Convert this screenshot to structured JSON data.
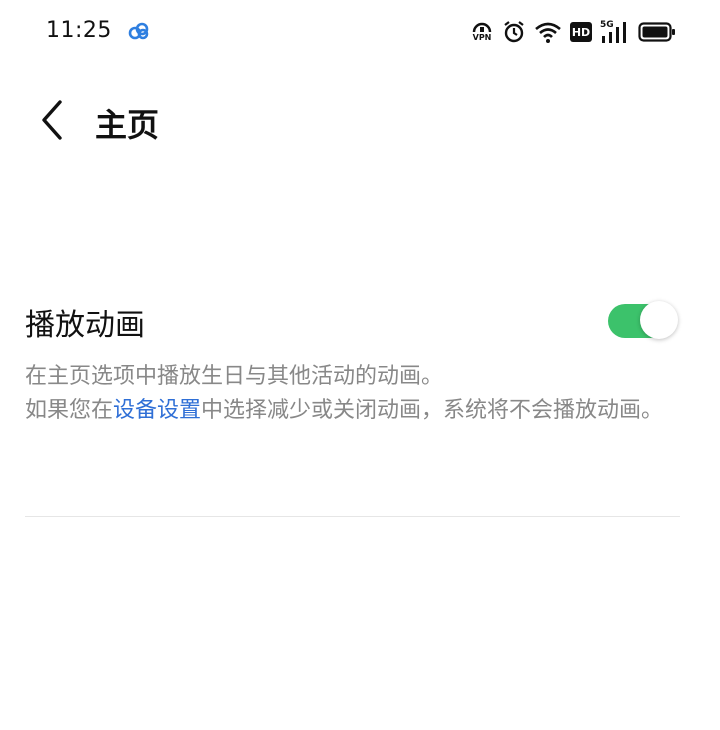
{
  "status_bar": {
    "time": "11:25",
    "network_label": "5G",
    "hd_label": "HD",
    "vpn_label": "VPN"
  },
  "header": {
    "title": "主页"
  },
  "setting": {
    "label": "播放动画",
    "enabled": true,
    "description_line1": "在主页选项中播放生日与其他活动的动画。",
    "description_pre": "如果您在",
    "description_link": "设备设置",
    "description_post": "中选择减少或关闭动画，系统将不会播放动画。"
  },
  "colors": {
    "toggle_on": "#3cc26b",
    "link": "#2f6fd6",
    "secondary_text": "#888888"
  },
  "icons": {
    "cloud": "cloud-sync-icon",
    "vpn": "vpn-icon",
    "alarm": "alarm-icon",
    "wifi": "wifi-icon",
    "hd": "hd-icon",
    "signal": "signal-icon",
    "battery": "battery-icon",
    "back": "back-arrow-icon"
  }
}
